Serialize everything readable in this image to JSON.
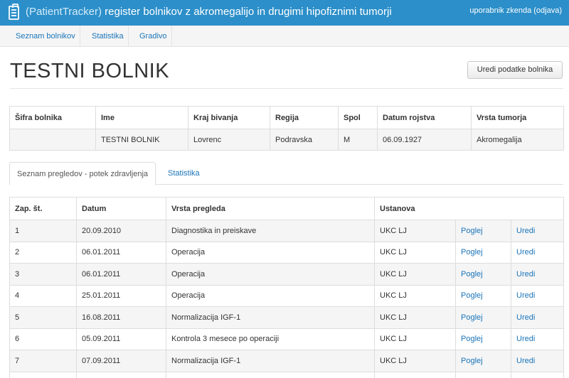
{
  "header": {
    "app_name": "(PatientTracker)",
    "subtitle": "register bolnikov z akromegalijo in drugimi hipofiznimi tumorji",
    "user_label": "uporabnik zkenda",
    "logout_label": "(odjava)"
  },
  "nav": {
    "items": [
      {
        "label": "Seznam bolnikov"
      },
      {
        "label": "Statistika"
      },
      {
        "label": "Gradivo"
      }
    ]
  },
  "page": {
    "title": "TESTNI BOLNIK",
    "edit_button": "Uredi podatke bolnika"
  },
  "patient": {
    "headers": [
      "Šifra bolnika",
      "Ime",
      "Kraj bivanja",
      "Regija",
      "Spol",
      "Datum rojstva",
      "Vrsta tumorja"
    ],
    "row": [
      "",
      "TESTNI BOLNIK",
      "Lovrenc",
      "Podravska",
      "M",
      "06.09.1927",
      "Akromegalija"
    ]
  },
  "tabs": [
    {
      "label": "Seznam pregledov - potek zdravljenja",
      "active": true
    },
    {
      "label": "Statistika",
      "active": false
    }
  ],
  "visits": {
    "headers": [
      "Zap. št.",
      "Datum",
      "Vrsta pregleda",
      "Ustanova"
    ],
    "view_label": "Poglej",
    "edit_label": "Uredi",
    "rows": [
      {
        "num": "1",
        "date": "20.09.2010",
        "type": "Diagnostika in preiskave",
        "inst": "UKC LJ"
      },
      {
        "num": "2",
        "date": "06.01.2011",
        "type": "Operacija",
        "inst": "UKC LJ"
      },
      {
        "num": "3",
        "date": "06.01.2011",
        "type": "Operacija",
        "inst": "UKC LJ"
      },
      {
        "num": "4",
        "date": "25.01.2011",
        "type": "Operacija",
        "inst": "UKC LJ"
      },
      {
        "num": "5",
        "date": "16.08.2011",
        "type": "Normalizacija IGF-1",
        "inst": "UKC LJ"
      },
      {
        "num": "6",
        "date": "05.09.2011",
        "type": "Kontrola 3 mesece po operaciji",
        "inst": "UKC LJ"
      },
      {
        "num": "7",
        "date": "07.09.2011",
        "type": "Normalizacija IGF-1",
        "inst": "UKC LJ"
      },
      {
        "num": "",
        "date": "",
        "type": "",
        "inst": ""
      }
    ]
  },
  "colors": {
    "header_bg": "#2c8fc9",
    "link": "#1a74b9"
  }
}
